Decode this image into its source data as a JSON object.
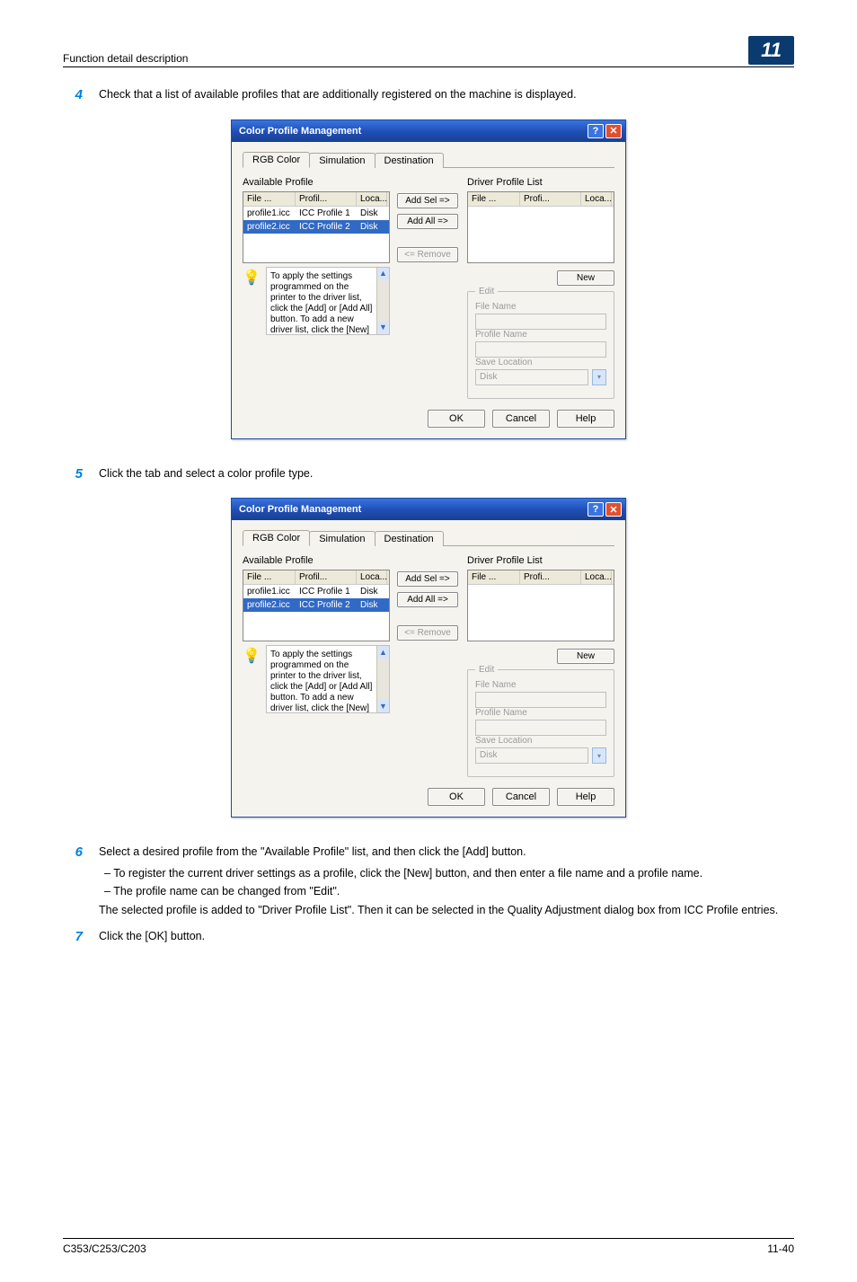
{
  "header": {
    "section": "Function detail description",
    "chapter": "11"
  },
  "steps": {
    "s4": {
      "num": "4",
      "text": "Check that a list of available profiles that are additionally registered on the machine is displayed."
    },
    "s5": {
      "num": "5",
      "text": "Click the tab and select a color profile type."
    },
    "s6": {
      "num": "6",
      "text": "Select a desired profile from the \"Available Profile\" list, and then click the [Add] button.",
      "sub1": "–   To register the current driver settings as a profile, click the [New] button, and then enter a file name and a profile name.",
      "sub2": "–   The profile name can be changed from \"Edit\".",
      "after": "The selected profile is added to \"Driver Profile List\". Then it can be selected in the Quality Adjustment dialog box from ICC Profile entries."
    },
    "s7": {
      "num": "7",
      "text": "Click the [OK] button."
    }
  },
  "dialog": {
    "title": "Color Profile Management",
    "tabs": {
      "t1": "RGB Color",
      "t2": "Simulation",
      "t3": "Destination"
    },
    "available_label": "Available Profile",
    "driver_label": "Driver Profile List",
    "cols": {
      "file": "File ...",
      "profile": "Profil...",
      "loca": "Loca...",
      "profi": "Profi..."
    },
    "rows": {
      "r1_file": "profile1.icc",
      "r1_prof": "ICC Profile 1",
      "r1_loc": "Disk",
      "r2_file": "profile2.icc",
      "r2_prof": "ICC Profile 2",
      "r2_loc": "Disk"
    },
    "btns": {
      "add_sel": "Add Sel =>",
      "add_all": "Add All =>",
      "remove": "<= Remove",
      "new": "New"
    },
    "help_text": "To apply the settings programmed on the printer to the driver list, click the [Add] or [Add All] button. To add a new driver list, click the [New] button, and then type",
    "edit": {
      "title": "Edit",
      "file_name": "File Name",
      "profile_name": "Profile Name",
      "save_location": "Save Location",
      "disk": "Disk"
    },
    "actions": {
      "ok": "OK",
      "cancel": "Cancel",
      "help": "Help"
    }
  },
  "footer": {
    "left": "C353/C253/C203",
    "right": "11-40"
  }
}
